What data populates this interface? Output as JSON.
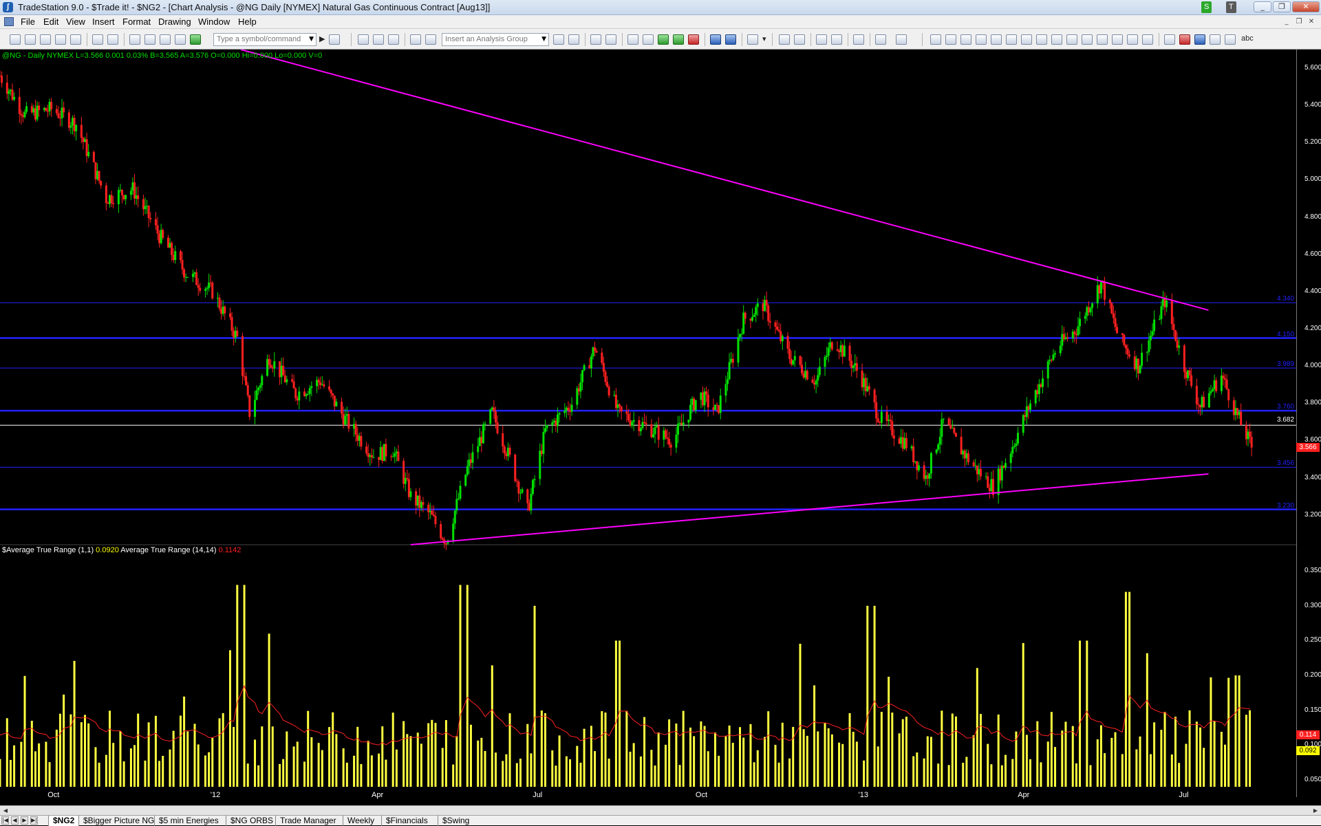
{
  "window": {
    "title": "TradeStation 9.0 - $Trade it! - $NG2 - [Chart Analysis - @NG Daily [NYMEX] Natural Gas Continuous Contract [Aug13]]",
    "badge_s": "S",
    "badge_t": "T"
  },
  "menu": [
    "File",
    "Edit",
    "View",
    "Insert",
    "Format",
    "Drawing",
    "Window",
    "Help"
  ],
  "toolbar": {
    "symbol_placeholder": "Type a symbol/command",
    "analysis_group_placeholder": "Insert an Analysis Group",
    "text_tool": "abc"
  },
  "legend": {
    "price": "@NG - Daily  NYMEX  L=3.566  0.001  0.03%  B=3.565  A=3.576  O=0.000  Hi=0.000  Lo=0.000  V=0",
    "atr1_label": "$Average True Range (1,1)",
    "atr1_value": "0.0920",
    "atr14_label": "Average True Range (14,14)",
    "atr14_value": "0.1142"
  },
  "chart_data": {
    "type": "candlestick",
    "symbol": "@NG",
    "interval": "Daily",
    "price_axis_ticks": [
      "5.600",
      "5.400",
      "5.200",
      "5.000",
      "4.800",
      "4.600",
      "4.400",
      "4.200",
      "4.000",
      "3.800",
      "3.600",
      "3.400",
      "3.200"
    ],
    "ylim": [
      3.04,
      5.7
    ],
    "x_axis_ticks": [
      "Oct",
      "'12",
      "Apr",
      "Jul",
      "Oct",
      "'13",
      "Apr",
      "Jul"
    ],
    "horizontal_levels": [
      {
        "value": 4.34,
        "label": "4.340",
        "color": "#2222ff",
        "weight": "thin"
      },
      {
        "value": 4.15,
        "label": "4.150",
        "color": "#2222ff",
        "weight": "thick"
      },
      {
        "value": 3.989,
        "label": "3.989",
        "color": "#2222ff",
        "weight": "thin"
      },
      {
        "value": 3.76,
        "label": "3.760",
        "color": "#2222ff",
        "weight": "thick"
      },
      {
        "value": 3.682,
        "label": "3.682",
        "color": "#ffffff",
        "weight": "thin"
      },
      {
        "value": 3.456,
        "label": "3.456",
        "color": "#2222ff",
        "weight": "thin"
      },
      {
        "value": 3.23,
        "label": "3.230",
        "color": "#2222ff",
        "weight": "thick"
      }
    ],
    "last_price": "3.566",
    "trendlines": [
      {
        "name": "resistance",
        "color": "#ff00ff",
        "from": {
          "date": "2012-01-15",
          "value": 5.7
        },
        "to": {
          "date": "2013-07-03",
          "value": 4.3
        }
      },
      {
        "name": "support",
        "color": "#ff00ff",
        "from": {
          "date": "2012-04-20",
          "value": 3.04
        },
        "to": {
          "date": "2013-07-03",
          "value": 3.42
        }
      }
    ],
    "close_path": [
      [
        "2011-09-01",
        5.56
      ],
      [
        "2011-09-15",
        5.35
      ],
      [
        "2011-09-30",
        5.38
      ],
      [
        "2011-10-14",
        5.3
      ],
      [
        "2011-10-31",
        4.9
      ],
      [
        "2011-11-15",
        4.95
      ],
      [
        "2011-11-30",
        4.7
      ],
      [
        "2011-12-15",
        4.5
      ],
      [
        "2011-12-30",
        4.4
      ],
      [
        "2012-01-13",
        4.15
      ],
      [
        "2012-01-20",
        3.75
      ],
      [
        "2012-01-31",
        4.05
      ],
      [
        "2012-02-15",
        3.85
      ],
      [
        "2012-02-29",
        3.92
      ],
      [
        "2012-03-15",
        3.7
      ],
      [
        "2012-03-30",
        3.52
      ],
      [
        "2012-04-10",
        3.55
      ],
      [
        "2012-04-20",
        3.3
      ],
      [
        "2012-05-01",
        3.2
      ],
      [
        "2012-05-10",
        3.06
      ],
      [
        "2012-05-22",
        3.45
      ],
      [
        "2012-06-05",
        3.75
      ],
      [
        "2012-06-15",
        3.5
      ],
      [
        "2012-06-25",
        3.22
      ],
      [
        "2012-07-05",
        3.65
      ],
      [
        "2012-07-20",
        3.8
      ],
      [
        "2012-08-02",
        4.1
      ],
      [
        "2012-08-15",
        3.75
      ],
      [
        "2012-08-30",
        3.68
      ],
      [
        "2012-09-15",
        3.6
      ],
      [
        "2012-09-30",
        3.85
      ],
      [
        "2012-10-10",
        3.75
      ],
      [
        "2012-10-25",
        4.25
      ],
      [
        "2012-11-05",
        4.33
      ],
      [
        "2012-11-20",
        4.05
      ],
      [
        "2012-12-05",
        3.92
      ],
      [
        "2012-12-15",
        4.15
      ],
      [
        "2012-12-30",
        3.95
      ],
      [
        "2013-01-10",
        3.72
      ],
      [
        "2013-01-25",
        3.58
      ],
      [
        "2013-02-05",
        3.4
      ],
      [
        "2013-02-15",
        3.7
      ],
      [
        "2013-02-25",
        3.55
      ],
      [
        "2013-03-05",
        3.45
      ],
      [
        "2013-03-15",
        3.35
      ],
      [
        "2013-03-25",
        3.55
      ],
      [
        "2013-04-05",
        3.8
      ],
      [
        "2013-04-20",
        4.1
      ],
      [
        "2013-05-01",
        4.2
      ],
      [
        "2013-05-15",
        4.45
      ],
      [
        "2013-05-25",
        4.15
      ],
      [
        "2013-06-05",
        4.0
      ],
      [
        "2013-06-20",
        4.35
      ],
      [
        "2013-07-01",
        4.0
      ],
      [
        "2013-07-10",
        3.78
      ],
      [
        "2013-07-22",
        3.95
      ],
      [
        "2013-07-31",
        3.73
      ],
      [
        "2013-08-08",
        3.566
      ]
    ],
    "atr_panel": {
      "ylim": [
        0.04,
        0.37
      ],
      "ticks": [
        "0.350",
        "0.300",
        "0.250",
        "0.200",
        "0.150",
        "0.100",
        "0.050"
      ],
      "series": [
        {
          "name": "$Average True Range (1,1)",
          "color": "#ffff00",
          "last": "0.092"
        },
        {
          "name": "Average True Range (14,14)",
          "color": "#ff2020",
          "last": "0.114"
        }
      ],
      "spikes": [
        [
          "2012-01-15",
          0.33
        ],
        [
          "2012-01-30",
          0.26
        ],
        [
          "2012-05-20",
          0.33
        ],
        [
          "2012-06-30",
          0.3
        ],
        [
          "2012-08-15",
          0.25
        ],
        [
          "2013-01-05",
          0.3
        ],
        [
          "2013-05-05",
          0.25
        ],
        [
          "2013-05-30",
          0.32
        ],
        [
          "2013-08-01",
          0.2
        ]
      ]
    }
  },
  "tabs": [
    "$NG2",
    "$Bigger Picture NG",
    "$5 min Energies",
    "$NG ORBS",
    "Trade Manager",
    "Weekly",
    "$Financials",
    "$Swing"
  ]
}
